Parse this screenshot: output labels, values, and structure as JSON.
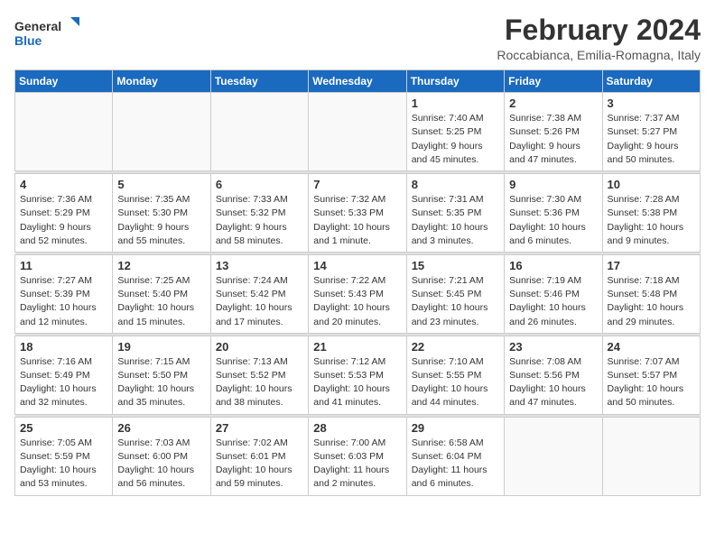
{
  "logo": {
    "general": "General",
    "blue": "Blue"
  },
  "title": "February 2024",
  "subtitle": "Roccabianca, Emilia-Romagna, Italy",
  "headers": [
    "Sunday",
    "Monday",
    "Tuesday",
    "Wednesday",
    "Thursday",
    "Friday",
    "Saturday"
  ],
  "weeks": [
    [
      {
        "day": "",
        "info": ""
      },
      {
        "day": "",
        "info": ""
      },
      {
        "day": "",
        "info": ""
      },
      {
        "day": "",
        "info": ""
      },
      {
        "day": "1",
        "info": "Sunrise: 7:40 AM\nSunset: 5:25 PM\nDaylight: 9 hours\nand 45 minutes."
      },
      {
        "day": "2",
        "info": "Sunrise: 7:38 AM\nSunset: 5:26 PM\nDaylight: 9 hours\nand 47 minutes."
      },
      {
        "day": "3",
        "info": "Sunrise: 7:37 AM\nSunset: 5:27 PM\nDaylight: 9 hours\nand 50 minutes."
      }
    ],
    [
      {
        "day": "4",
        "info": "Sunrise: 7:36 AM\nSunset: 5:29 PM\nDaylight: 9 hours\nand 52 minutes."
      },
      {
        "day": "5",
        "info": "Sunrise: 7:35 AM\nSunset: 5:30 PM\nDaylight: 9 hours\nand 55 minutes."
      },
      {
        "day": "6",
        "info": "Sunrise: 7:33 AM\nSunset: 5:32 PM\nDaylight: 9 hours\nand 58 minutes."
      },
      {
        "day": "7",
        "info": "Sunrise: 7:32 AM\nSunset: 5:33 PM\nDaylight: 10 hours\nand 1 minute."
      },
      {
        "day": "8",
        "info": "Sunrise: 7:31 AM\nSunset: 5:35 PM\nDaylight: 10 hours\nand 3 minutes."
      },
      {
        "day": "9",
        "info": "Sunrise: 7:30 AM\nSunset: 5:36 PM\nDaylight: 10 hours\nand 6 minutes."
      },
      {
        "day": "10",
        "info": "Sunrise: 7:28 AM\nSunset: 5:38 PM\nDaylight: 10 hours\nand 9 minutes."
      }
    ],
    [
      {
        "day": "11",
        "info": "Sunrise: 7:27 AM\nSunset: 5:39 PM\nDaylight: 10 hours\nand 12 minutes."
      },
      {
        "day": "12",
        "info": "Sunrise: 7:25 AM\nSunset: 5:40 PM\nDaylight: 10 hours\nand 15 minutes."
      },
      {
        "day": "13",
        "info": "Sunrise: 7:24 AM\nSunset: 5:42 PM\nDaylight: 10 hours\nand 17 minutes."
      },
      {
        "day": "14",
        "info": "Sunrise: 7:22 AM\nSunset: 5:43 PM\nDaylight: 10 hours\nand 20 minutes."
      },
      {
        "day": "15",
        "info": "Sunrise: 7:21 AM\nSunset: 5:45 PM\nDaylight: 10 hours\nand 23 minutes."
      },
      {
        "day": "16",
        "info": "Sunrise: 7:19 AM\nSunset: 5:46 PM\nDaylight: 10 hours\nand 26 minutes."
      },
      {
        "day": "17",
        "info": "Sunrise: 7:18 AM\nSunset: 5:48 PM\nDaylight: 10 hours\nand 29 minutes."
      }
    ],
    [
      {
        "day": "18",
        "info": "Sunrise: 7:16 AM\nSunset: 5:49 PM\nDaylight: 10 hours\nand 32 minutes."
      },
      {
        "day": "19",
        "info": "Sunrise: 7:15 AM\nSunset: 5:50 PM\nDaylight: 10 hours\nand 35 minutes."
      },
      {
        "day": "20",
        "info": "Sunrise: 7:13 AM\nSunset: 5:52 PM\nDaylight: 10 hours\nand 38 minutes."
      },
      {
        "day": "21",
        "info": "Sunrise: 7:12 AM\nSunset: 5:53 PM\nDaylight: 10 hours\nand 41 minutes."
      },
      {
        "day": "22",
        "info": "Sunrise: 7:10 AM\nSunset: 5:55 PM\nDaylight: 10 hours\nand 44 minutes."
      },
      {
        "day": "23",
        "info": "Sunrise: 7:08 AM\nSunset: 5:56 PM\nDaylight: 10 hours\nand 47 minutes."
      },
      {
        "day": "24",
        "info": "Sunrise: 7:07 AM\nSunset: 5:57 PM\nDaylight: 10 hours\nand 50 minutes."
      }
    ],
    [
      {
        "day": "25",
        "info": "Sunrise: 7:05 AM\nSunset: 5:59 PM\nDaylight: 10 hours\nand 53 minutes."
      },
      {
        "day": "26",
        "info": "Sunrise: 7:03 AM\nSunset: 6:00 PM\nDaylight: 10 hours\nand 56 minutes."
      },
      {
        "day": "27",
        "info": "Sunrise: 7:02 AM\nSunset: 6:01 PM\nDaylight: 10 hours\nand 59 minutes."
      },
      {
        "day": "28",
        "info": "Sunrise: 7:00 AM\nSunset: 6:03 PM\nDaylight: 11 hours\nand 2 minutes."
      },
      {
        "day": "29",
        "info": "Sunrise: 6:58 AM\nSunset: 6:04 PM\nDaylight: 11 hours\nand 6 minutes."
      },
      {
        "day": "",
        "info": ""
      },
      {
        "day": "",
        "info": ""
      }
    ]
  ]
}
